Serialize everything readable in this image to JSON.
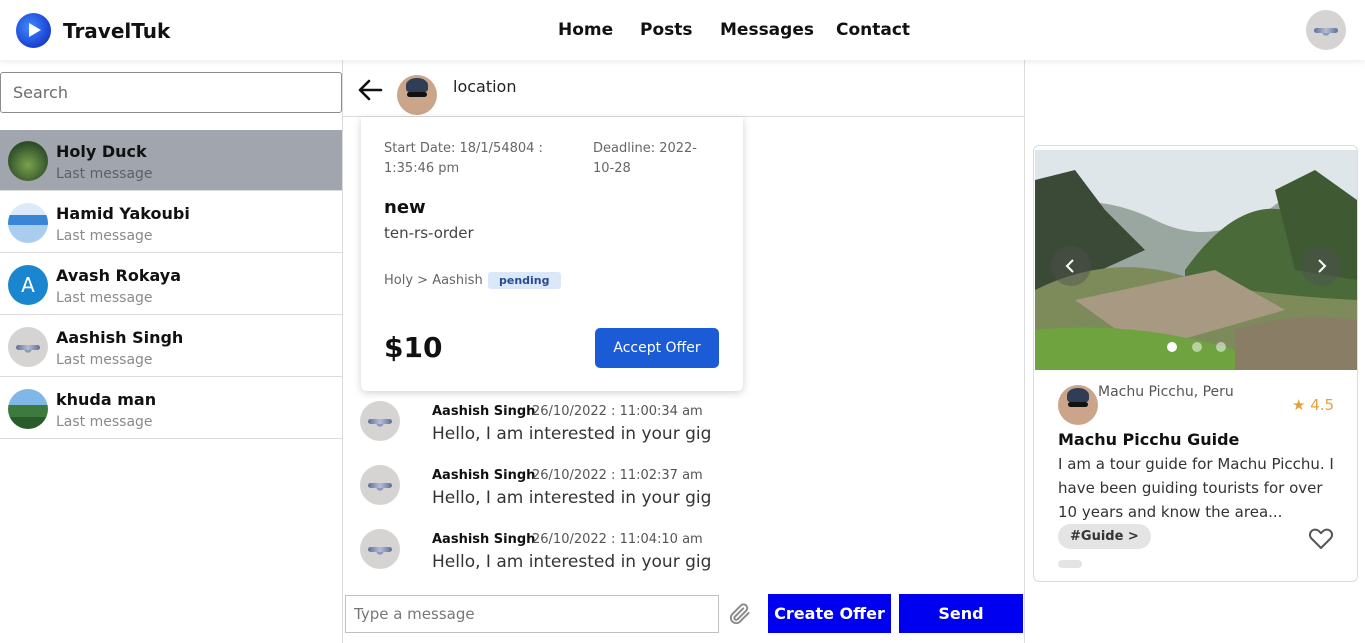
{
  "app": {
    "title": "TravelTuk"
  },
  "nav": {
    "items": [
      "Home",
      "Posts",
      "Messages",
      "Contact"
    ]
  },
  "sidebar": {
    "search_placeholder": "Search",
    "chats": [
      {
        "name": "Holy Duck",
        "subtitle": "Last message"
      },
      {
        "name": "Hamid Yakoubi",
        "subtitle": "Last message"
      },
      {
        "name": "Avash Rokaya",
        "subtitle": "Last message",
        "initial": "A"
      },
      {
        "name": "Aashish Singh",
        "subtitle": "Last message"
      },
      {
        "name": "khuda man",
        "subtitle": "Last message"
      }
    ]
  },
  "chat": {
    "header_title": "location",
    "offer": {
      "start_date": "Start Date: 18/1/54804 : 1:35:46 pm",
      "deadline": "Deadline: 2022-10-28",
      "title": "new",
      "subtitle": "ten-rs-order",
      "route": "Holy > Aashish",
      "status": "pending",
      "price": "$10",
      "accept_label": "Accept Offer"
    },
    "messages": [
      {
        "sender": "Aashish Singh",
        "time": "26/10/2022 : 11:00:34 am",
        "text": "Hello, I am interested in your gig"
      },
      {
        "sender": "Aashish Singh",
        "time": "26/10/2022 : 11:02:37 am",
        "text": "Hello, I am interested in your gig"
      },
      {
        "sender": "Aashish Singh",
        "time": "26/10/2022 : 11:04:10 am",
        "text": "Hello, I am interested in your gig"
      }
    ],
    "input_placeholder": "Type a message",
    "create_offer_label": "Create Offer",
    "send_label": "Send"
  },
  "gig": {
    "location": "Machu Picchu, Peru",
    "rating": "★ 4.5",
    "title": "Machu Picchu Guide",
    "description": "I am a tour guide for Machu Picchu. I have been guiding tourists for over 10 years and know the area...",
    "tag": "#Guide >"
  },
  "colors": {
    "primary_button": "#0000f0",
    "accept_button": "#1c5bd6",
    "active_chat": "#a1a5ae",
    "rating": "#e6a13a"
  }
}
